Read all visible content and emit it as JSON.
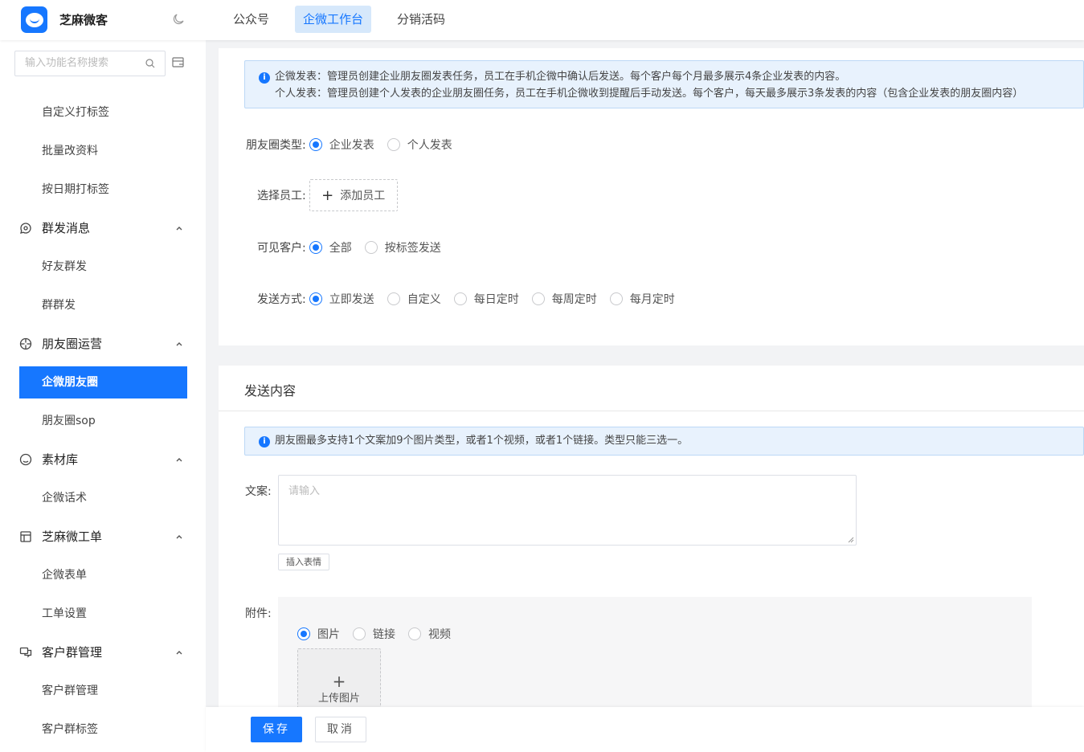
{
  "header": {
    "app_name": "芝麻微客",
    "tabs": [
      {
        "label": "公众号"
      },
      {
        "label": "企微工作台"
      },
      {
        "label": "分销活码"
      }
    ]
  },
  "sidebar": {
    "search_placeholder": "输入功能名称搜索",
    "items": [
      {
        "label": "自定义打标签"
      },
      {
        "label": "批量改资料"
      },
      {
        "label": "按日期打标签"
      },
      {
        "label": "群发消息"
      },
      {
        "label": "好友群发"
      },
      {
        "label": "群群发"
      },
      {
        "label": "朋友圈运营"
      },
      {
        "label": "企微朋友圈"
      },
      {
        "label": "朋友圈sop"
      },
      {
        "label": "素材库"
      },
      {
        "label": "企微话术"
      },
      {
        "label": "芝麻微工单"
      },
      {
        "label": "企微表单"
      },
      {
        "label": "工单设置"
      },
      {
        "label": "客户群管理"
      },
      {
        "label": "客户群管理"
      },
      {
        "label": "客户群标签"
      }
    ]
  },
  "settings": {
    "info_line1": "企微发表：管理员创建企业朋友圈发表任务，员工在手机企微中确认后发送。每个客户每个月最多展示4条企业发表的内容。",
    "info_line2": "个人发表：管理员创建个人发表的企业朋友圈任务，员工在手机企微收到提醒后手动发送。每个客户，每天最多展示3条发表的内容（包含企业发表的朋友圈内容）",
    "moments_type_label": "朋友圈类型:",
    "moments_type_options": [
      "企业发表",
      "个人发表"
    ],
    "employee_label": "选择员工:",
    "add_employee": "添加员工",
    "visible_label": "可见客户:",
    "visible_options": [
      "全部",
      "按标签发送"
    ],
    "send_label": "发送方式:",
    "send_options": [
      "立即发送",
      "自定义",
      "每日定时",
      "每周定时",
      "每月定时"
    ]
  },
  "content": {
    "title": "发送内容",
    "info": "朋友圈最多支持1个文案加9个图片类型，或者1个视频，或者1个链接。类型只能三选一。",
    "copy_label": "文案:",
    "copy_placeholder": "请输入",
    "emoji_button": "插入表情",
    "attach_label": "附件:",
    "attach_options": [
      "图片",
      "链接",
      "视频"
    ],
    "upload_label": "上传图片"
  },
  "footer": {
    "save": "保存",
    "cancel": "取消"
  },
  "colors": {
    "primary": "#1677ff",
    "info_bg": "#e8f2fd"
  }
}
